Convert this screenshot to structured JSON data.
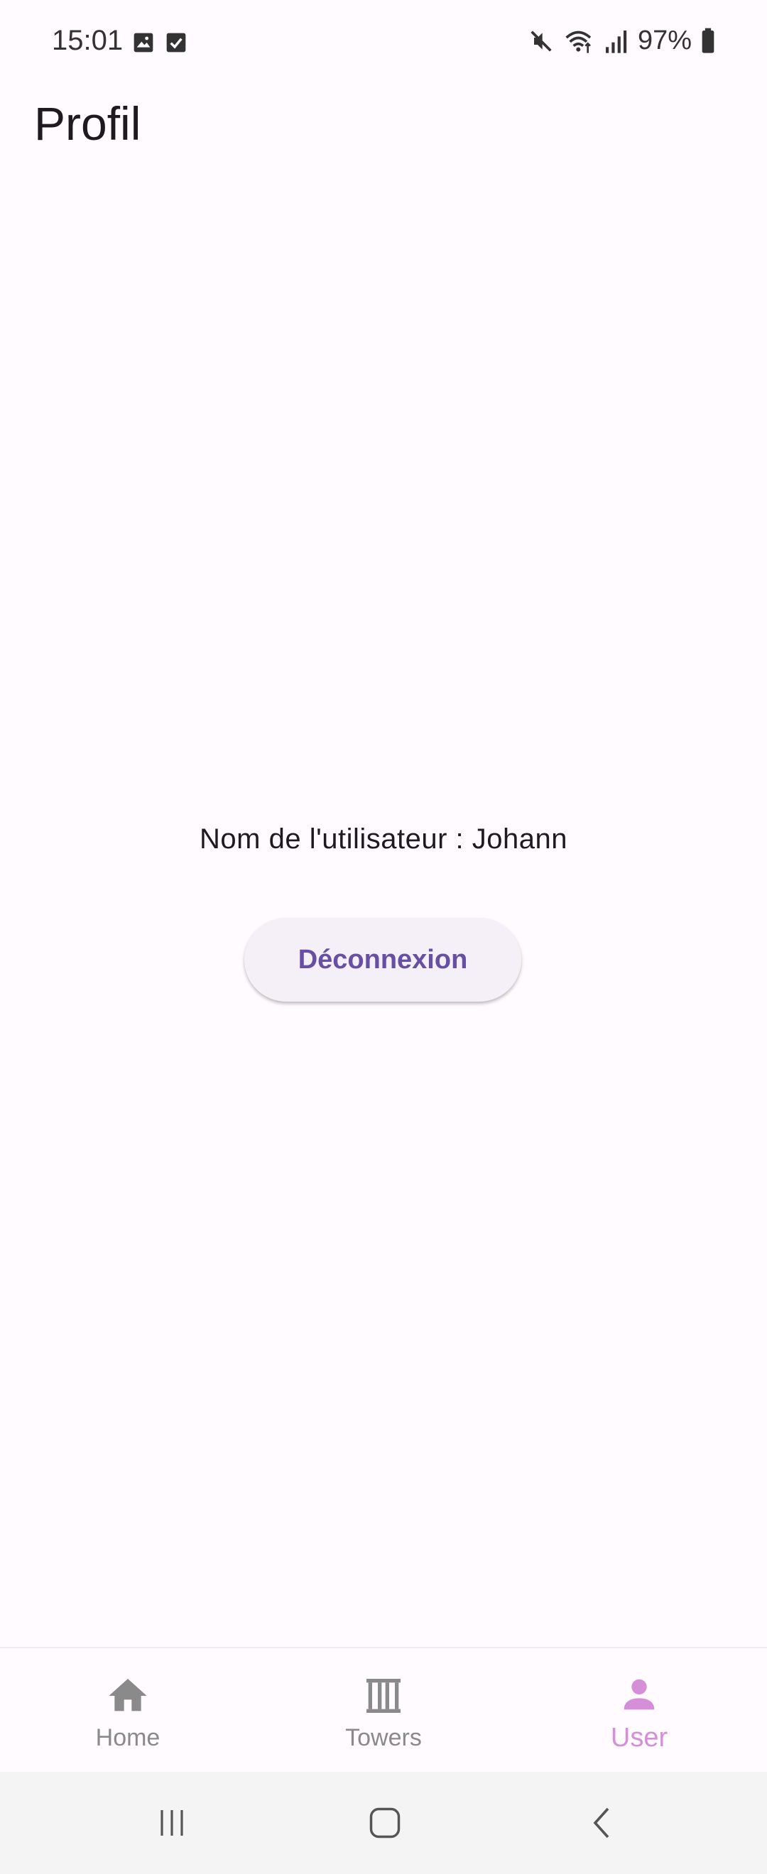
{
  "status_bar": {
    "time": "15:01",
    "battery": "97%",
    "icons": [
      "image-icon",
      "checkbox-icon",
      "mute-icon",
      "wifi-icon",
      "signal-icon",
      "battery-icon"
    ]
  },
  "app_bar": {
    "title": "Profil"
  },
  "profile": {
    "username_text": "Nom de l'utilisateur : Johann",
    "logout_label": "Déconnexion"
  },
  "bottom_nav": {
    "items": [
      {
        "label": "Home",
        "icon": "home-icon",
        "active": false
      },
      {
        "label": "Towers",
        "icon": "towers-icon",
        "active": false
      },
      {
        "label": "User",
        "icon": "user-icon",
        "active": true
      }
    ]
  },
  "colors": {
    "background": "#fffbfe",
    "primary": "#6750a4",
    "active_nav": "#d48fd8",
    "inactive_nav": "#8a8a8a",
    "button_bg": "#f5eff7"
  }
}
